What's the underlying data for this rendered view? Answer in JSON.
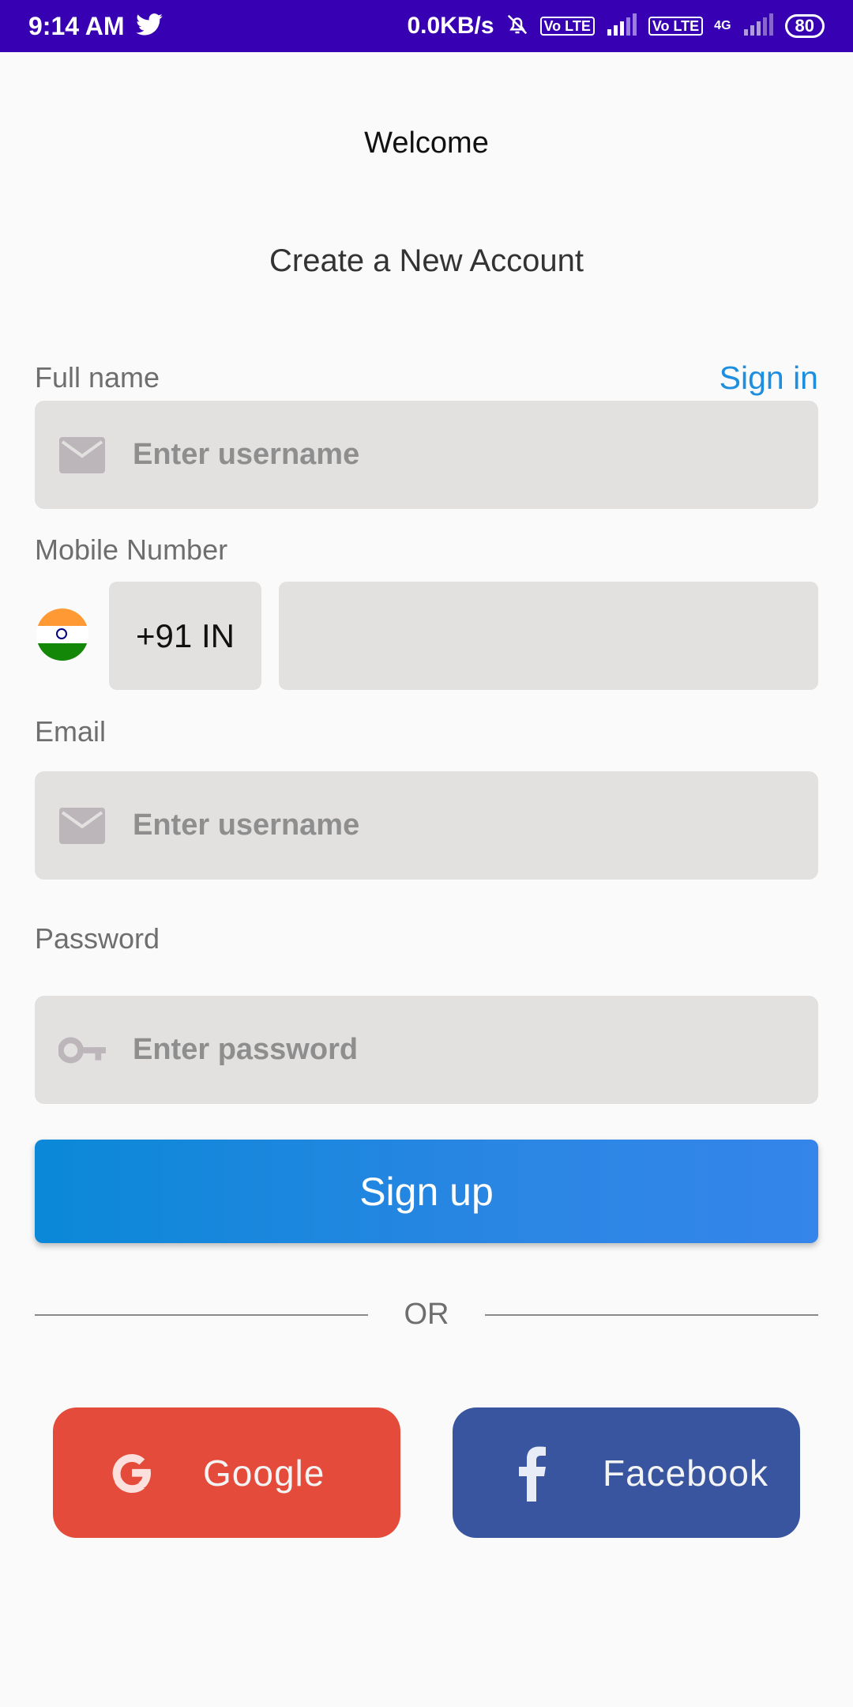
{
  "status_bar": {
    "time": "9:14 AM",
    "net_speed": "0.0KB/s",
    "volte_1": "Vo LTE",
    "volte_2": "Vo LTE",
    "network": "4G",
    "battery": "80"
  },
  "header": {
    "welcome": "Welcome",
    "subtitle": "Create a New Account"
  },
  "form": {
    "full_name_label": "Full name",
    "sign_in_link": "Sign in",
    "full_name_placeholder": "Enter username",
    "mobile_label": "Mobile Number",
    "country_code": "+91 IN",
    "email_label": "Email",
    "email_placeholder": "Enter username",
    "password_label": "Password",
    "password_placeholder": "Enter password",
    "signup_button": "Sign up"
  },
  "divider": {
    "text": "OR"
  },
  "social": {
    "google_label": "Google",
    "facebook_label": "Facebook"
  },
  "colors": {
    "status_bar": "#3700b3",
    "accent_link": "#1e8ee0",
    "signup_button": "#2a86e3",
    "google": "#e44b3b",
    "facebook": "#3955a0",
    "field_bg": "#e2e1e0"
  }
}
